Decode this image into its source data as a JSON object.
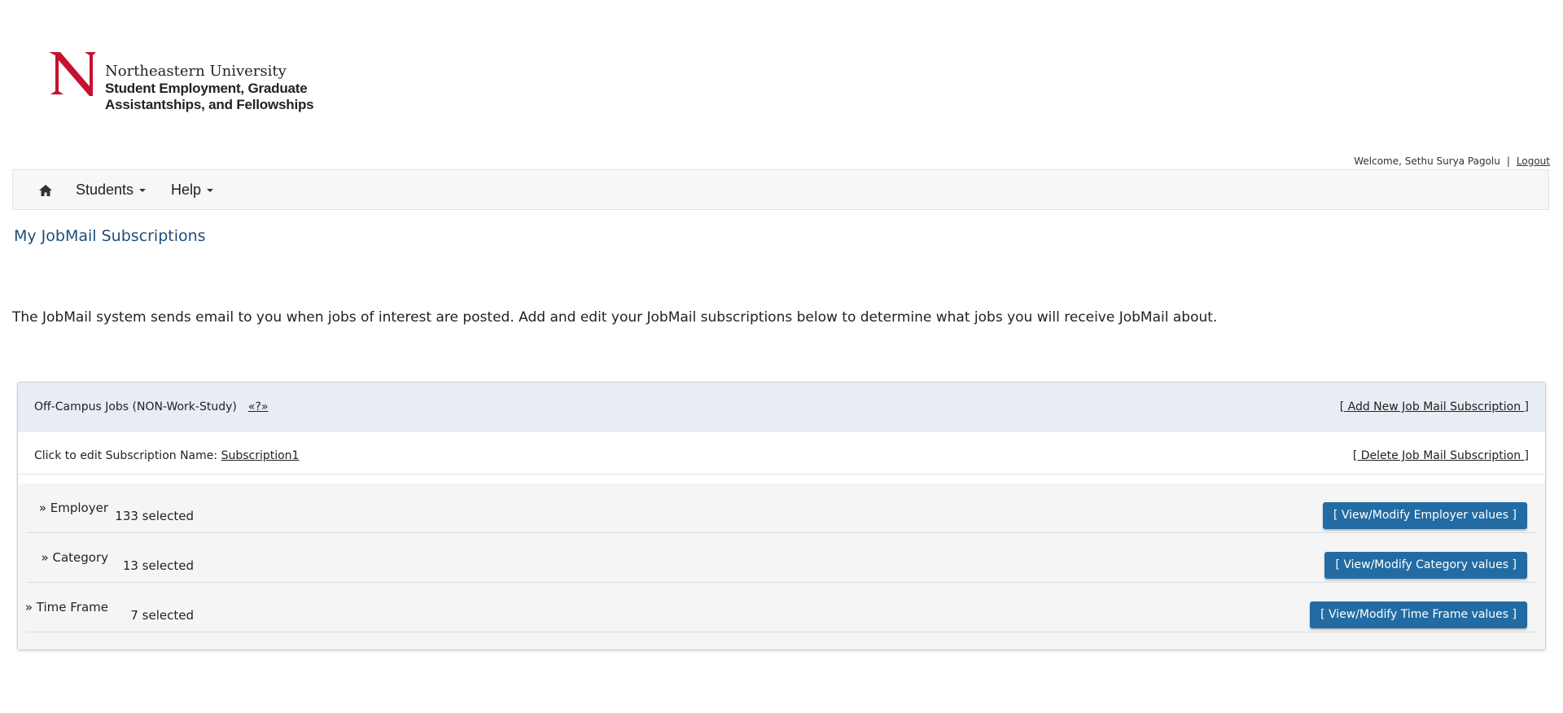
{
  "logo": {
    "university": "Northeastern University",
    "subtitle_line1": "Student Employment, Graduate",
    "subtitle_line2": "Assistantships, and Fellowships",
    "brand_color": "#c8102e"
  },
  "header": {
    "welcome": "Welcome, Sethu Surya Pagolu",
    "separator": "|",
    "logout": "Logout"
  },
  "nav": {
    "home_icon": "home-icon",
    "items": [
      {
        "label": "Students"
      },
      {
        "label": "Help"
      }
    ]
  },
  "page": {
    "title": "My JobMail Subscriptions",
    "intro": "The JobMail system sends email to you when jobs of interest are posted. Add and edit your JobMail subscriptions below to determine what jobs you will receive JobMail about."
  },
  "panel": {
    "title": "Off-Campus Jobs (NON-Work-Study)",
    "help": "«?»",
    "add_link": "[ Add New Job Mail Subscription ]",
    "edit_label": "Click to edit Subscription Name:",
    "subscription_name": "Subscription1",
    "delete_link": "[ Delete Job Mail Subscription ]",
    "criteria": [
      {
        "name": "» Employer",
        "count": "133 selected",
        "button": "[ View/Modify Employer values ]"
      },
      {
        "name": "» Category",
        "count": "13 selected",
        "button": "[ View/Modify Category values ]"
      },
      {
        "name": "» Time Frame",
        "count": "7 selected",
        "button": "[ View/Modify Time Frame values ]"
      }
    ]
  },
  "colors": {
    "accent_button": "#226ca3",
    "title_blue": "#1e4f7a",
    "panel_header": "#e8ecf3"
  }
}
